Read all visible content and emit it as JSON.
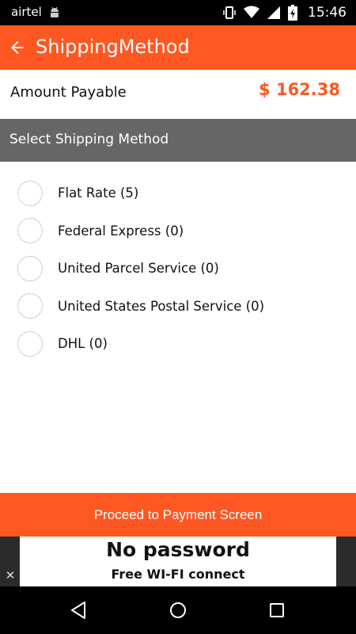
{
  "status_bar": {
    "carrier": "airtel",
    "time": "15:46"
  },
  "app_bar": {
    "title": "ShippingMethod"
  },
  "amount": {
    "label": "Amount Payable",
    "value": "$  162.38"
  },
  "section": {
    "title": "Select Shipping Method"
  },
  "shipping_options": [
    {
      "label": "Flat Rate (5)"
    },
    {
      "label": "Federal Express (0)"
    },
    {
      "label": "United Parcel Service (0)"
    },
    {
      "label": "United States Postal Service (0)"
    },
    {
      "label": "DHL (0)"
    }
  ],
  "proceed_button": {
    "label": "Proceed to Payment Screen"
  },
  "ad_banner": {
    "line1": "No password",
    "line2": "Free WI-FI connect",
    "close": "✕"
  },
  "colors": {
    "accent": "#ff5722",
    "header_gray": "#666666"
  }
}
